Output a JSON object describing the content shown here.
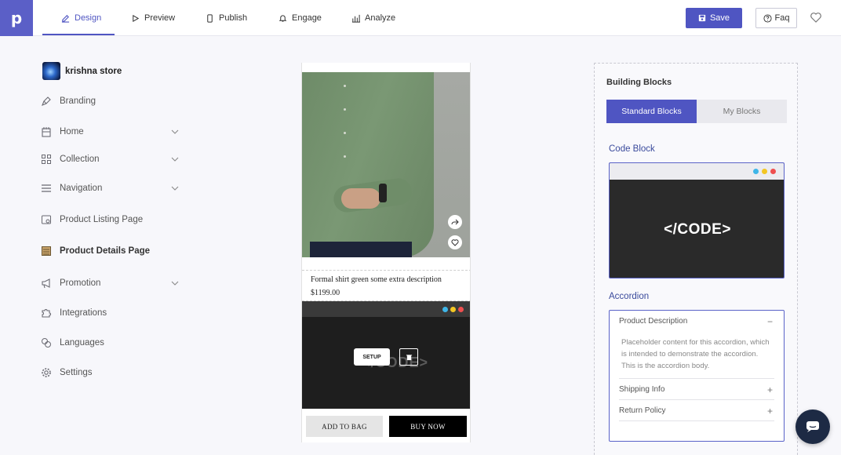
{
  "app": {
    "logo_letter": "p"
  },
  "tabs": [
    {
      "label": "Design",
      "icon": "edit-icon",
      "active": true
    },
    {
      "label": "Preview",
      "icon": "play-icon"
    },
    {
      "label": "Publish",
      "icon": "phone-icon"
    },
    {
      "label": "Engage",
      "icon": "bell-icon"
    },
    {
      "label": "Analyze",
      "icon": "bar-chart-icon"
    }
  ],
  "header_actions": {
    "save_label": "Save",
    "faq_label": "Faq"
  },
  "sidebar": {
    "store_name": "krishna store",
    "items": [
      {
        "label": "Branding",
        "icon": "brush-icon"
      },
      {
        "label": "Home",
        "icon": "building-icon",
        "expandable": true
      },
      {
        "label": "Collection",
        "icon": "grid-icon",
        "expandable": true
      },
      {
        "label": "Navigation",
        "icon": "menu-list-icon",
        "expandable": true
      },
      {
        "label": "Product Listing Page",
        "icon": "list-page-icon"
      },
      {
        "label": "Product Details Page",
        "icon": "details-page-icon",
        "active": true
      },
      {
        "label": "Promotion",
        "icon": "megaphone-icon",
        "expandable": true
      },
      {
        "label": "Integrations",
        "icon": "puzzle-icon"
      },
      {
        "label": "Languages",
        "icon": "translate-icon"
      },
      {
        "label": "Settings",
        "icon": "gear-icon"
      }
    ]
  },
  "preview": {
    "product_title": "Formal shirt green some extra description",
    "product_price": "$1199.00",
    "ghost_code_text": "</CODE>",
    "setup_label": "SETUP",
    "add_to_bag_label": "ADD TO BAG",
    "buy_now_label": "BUY NOW"
  },
  "building_blocks": {
    "title": "Building Blocks",
    "tab_standard": "Standard Blocks",
    "tab_my": "My Blocks",
    "code_block_label": "Code Block",
    "code_block_text": "</CODE>",
    "accordion_label": "Accordion",
    "accordion_items": [
      {
        "title": "Product Description",
        "sign": "−",
        "body": "Placeholder content for this accordion, which is intended to demonstrate the accordion. This is the accordion body."
      },
      {
        "title": "Shipping Info",
        "sign": "+"
      },
      {
        "title": "Return Policy",
        "sign": "+"
      }
    ]
  },
  "colors": {
    "accent": "#4f55c2",
    "dot_blue": "#3fb6e8",
    "dot_yellow": "#f3c623",
    "dot_red": "#ef4f4f"
  }
}
